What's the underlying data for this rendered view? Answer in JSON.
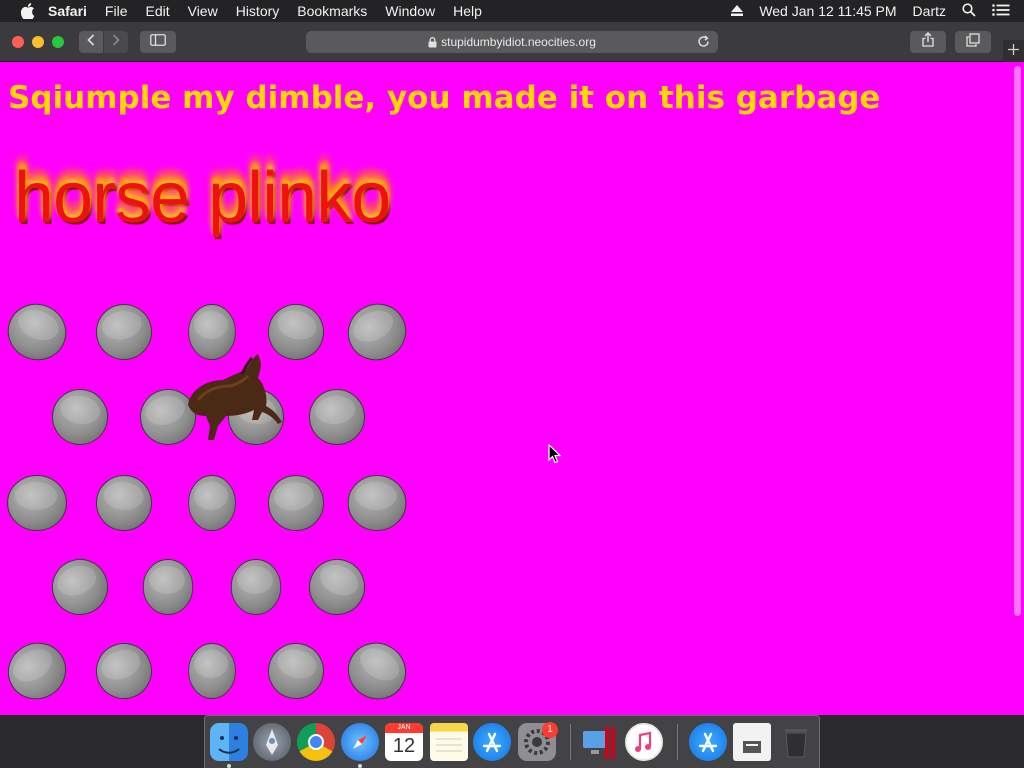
{
  "menubar": {
    "apple_icon": "apple-logo-icon",
    "app_name": "Safari",
    "items": [
      "File",
      "Edit",
      "View",
      "History",
      "Bookmarks",
      "Window",
      "Help"
    ],
    "eject_icon": "eject-icon",
    "datetime": "Wed Jan 12  11:45 PM",
    "user": "Dartz",
    "search_icon": "spotlight-search-icon",
    "list_icon": "notification-center-icon"
  },
  "browser": {
    "url": "stupidumbyidiot.neocities.org",
    "lock_icon": "lock-icon",
    "reload_icon": "reload-icon",
    "back_icon": "chevron-left-icon",
    "forward_icon": "chevron-right-icon",
    "sidebar_icon": "sidebar-icon",
    "share_icon": "share-icon",
    "tabs_icon": "tabs-overview-icon",
    "newtab_icon": "plus-icon"
  },
  "page": {
    "headline": "Sqiumple my dimble, you made it on this garbage",
    "fire_title": "horse plinko",
    "background_color": "#ff00ff",
    "headline_color": "#ffd800"
  },
  "dock": {
    "icons": [
      "finder-icon",
      "launchpad-icon",
      "chrome-icon",
      "safari-icon",
      "calendar-icon",
      "notes-icon",
      "app-store-icon",
      "system-preferences-icon",
      "parallels-icon",
      "itunes-icon",
      "app-store-folder-icon",
      "documents-folder-icon",
      "trash-icon"
    ],
    "calendar_month": "JAN",
    "calendar_day": "12",
    "badge_count": "1"
  }
}
